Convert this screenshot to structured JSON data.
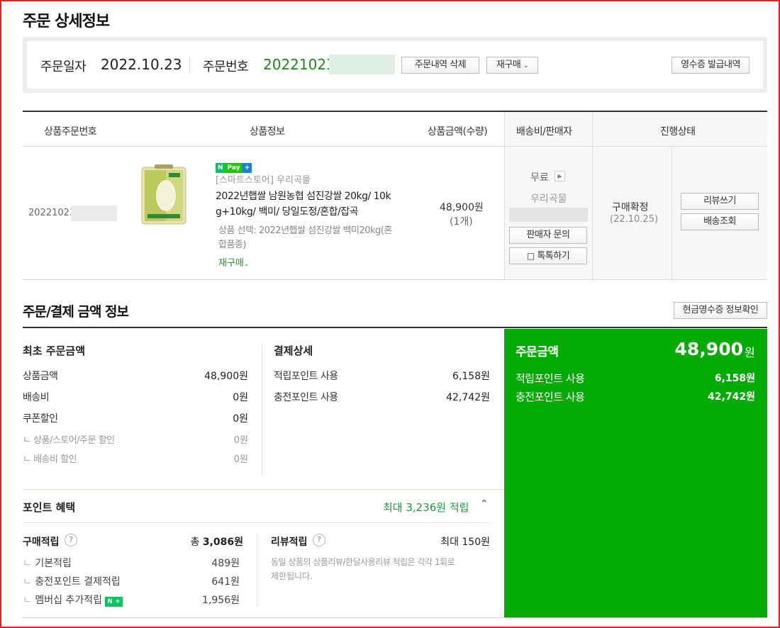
{
  "page": {
    "title": "주문 상세정보"
  },
  "order_info": {
    "date_label": "주문일자",
    "date_value": "2022.10.23",
    "number_label": "주문번호",
    "number_value": "20221023",
    "delete_btn": "주문내역 삭제",
    "reorder_btn": "재구매",
    "receipt_btn": "영수증 발급내역"
  },
  "table": {
    "headers": [
      "상품주문번호",
      "상품정보",
      "상품금액(수량)",
      "배송비/판매자",
      "진행상태"
    ],
    "row": {
      "order_no": "20221023",
      "npay": "Pay",
      "store": "[스마트스토어] 우리곡물",
      "product_name_1": "2022년햅쌀 남원농협 섬진강쌀 20kg/ 10k",
      "product_name_2": "g+10kg/ 백미/ 당일도정/혼합/잡곡",
      "option_1": "상품 선택: 2022년햅쌀 섬진강쌀 백미20kg(혼",
      "option_2": "합품종)",
      "reorder": "재구매",
      "price": "48,900원",
      "qty": "(1개)",
      "shipping": "무료",
      "seller": "우리곡물",
      "inquiry_btn": "판매자 문의",
      "talk_btn": "톡톡하기",
      "status": "구매확정",
      "status_date": "(22.10.25)",
      "review_btn": "리뷰쓰기",
      "tracking_btn": "배송조회"
    }
  },
  "payment": {
    "title": "주문/결제 금액 정보",
    "cash_receipt_btn": "현금영수증 정보확인",
    "initial": {
      "title": "최초 주문금액",
      "rows": [
        {
          "label": "상품금액",
          "value": "48,900원"
        },
        {
          "label": "배송비",
          "value": "0원"
        },
        {
          "label": "쿠폰할인",
          "value": "0원"
        }
      ],
      "subrows": [
        {
          "label": "ㄴ 상품/스토어/주문 할인",
          "value": "0원"
        },
        {
          "label": "ㄴ 배송비 할인",
          "value": "0원"
        }
      ]
    },
    "detail": {
      "title": "결제상세",
      "rows": [
        {
          "label": "적립포인트 사용",
          "value": "6,158원"
        },
        {
          "label": "충전포인트 사용",
          "value": "42,742원"
        }
      ]
    },
    "summary": {
      "title": "주문금액",
      "amount": "48,900",
      "unit": "원",
      "rows": [
        {
          "label": "적립포인트 사용",
          "value": "6,158원"
        },
        {
          "label": "충전포인트 사용",
          "value": "42,742원"
        }
      ]
    }
  },
  "points": {
    "title": "포인트 혜택",
    "max_label": "최대 3,236원 적립",
    "purchase": {
      "title": "구매적립",
      "total_prefix": "총",
      "total": "3,086원",
      "rows": [
        {
          "label": "기본적립",
          "value": "489원"
        },
        {
          "label": "충전포인트 결제적립",
          "value": "641원"
        },
        {
          "label": "멤버십 추가적립",
          "value": "1,956원"
        }
      ]
    },
    "review": {
      "title": "리뷰적립",
      "max": "최대 150원",
      "desc_1": "동일 상품의 상품리뷰/한달사용리뷰 적립은 각각 1회로",
      "desc_2": "제한됩니다."
    }
  }
}
